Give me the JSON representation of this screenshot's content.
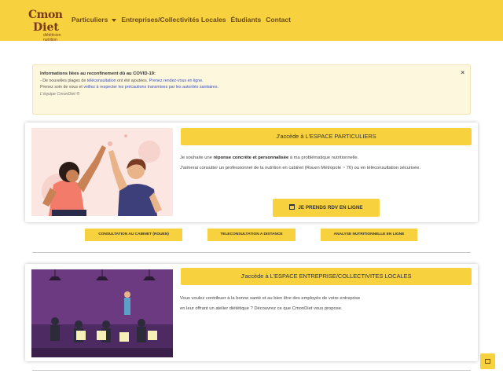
{
  "header": {
    "logo_line1": "Cmon",
    "logo_line2": "Diet",
    "logo_tag": "diététicien nutrition",
    "nav": [
      {
        "label": "Particuliers"
      },
      {
        "label": "Entreprises/Collectivités Locales"
      },
      {
        "label": "Étudiants"
      },
      {
        "label": "Contact"
      }
    ]
  },
  "alert": {
    "title": "Informations liées au reconfinement dû au COVID-19:",
    "line1_pre": "- De nouvelles plages de ",
    "line1_link": "téléconsultation",
    "line1_mid": " ont été ajoutées. ",
    "line1_link2": "Prenez rendez-vous en ligne.",
    "line2_pre": "Prenez soin de vous et ",
    "line2_link": "veillez à respecter les précautions transmises par les autorités sanitaires.",
    "signature": "L'équipe CmonDiet ®",
    "close": "×"
  },
  "card_particuliers": {
    "banner": "J'accède à L'ESPACE PARTICULIERS",
    "text_pre": "Je souhaite une ",
    "text_bold": "réponse concrète et personnalisée",
    "text_post": " à ma problématique nutritionnelle.",
    "text_line2": "J'aimerai consulter un professionnel de la nutrition en cabinet (Rouen Métropole ~ 76) ou en téléconsultation sécurisée.",
    "rdv_button": "JE PRENDS RDV EN LIGNE"
  },
  "sub_buttons": [
    {
      "label": "CONSULTATION AU CABINET (ROUEN)"
    },
    {
      "label": "TELECONSULTATION A DISTANCE"
    },
    {
      "label": "ANALYSE NUTRITIONNELLE EN LIGNE"
    }
  ],
  "card_entreprise": {
    "banner": "J'accède à L'ESPACE ENTREPRISE/COLLECTIVITES LOCALES",
    "text_line1": "Vous voulez contribuer à la bonne santé et au bien être des employés de votre entreprise",
    "text_line2": "en leur offrant un atelier diététique ? Découvrez ce que CmonDiet vous propose."
  },
  "colors": {
    "brand_yellow": "#f7d23e",
    "alert_bg": "#fdf7dd",
    "link_blue": "#3a4fc8",
    "nav_text": "#6b4a14"
  },
  "icons": {
    "scroll_top": "square-icon",
    "calendar": "calendar-icon",
    "nav_caret": "chevron-down-icon"
  }
}
